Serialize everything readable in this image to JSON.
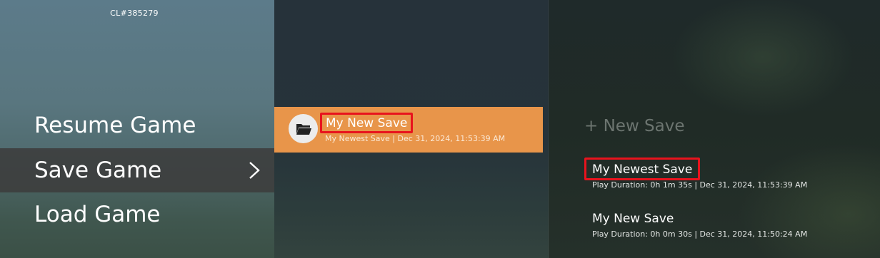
{
  "build_label": "CL#385279",
  "menu": {
    "items": [
      {
        "label": "Resume Game"
      },
      {
        "label": "Save Game"
      },
      {
        "label": "Load Game"
      }
    ]
  },
  "selected_save": {
    "title": "My New Save",
    "subtitle": "My Newest Save | Dec 31, 2024, 11:53:39 AM"
  },
  "save_list": {
    "new_save_label": "+ New Save",
    "entries": [
      {
        "title": "My Newest Save",
        "detail": "Play Duration: 0h 1m 35s | Dec 31, 2024, 11:53:39 AM"
      },
      {
        "title": "My New Save",
        "detail": "Play Duration: 0h 0m 30s | Dec 31, 2024, 11:50:24 AM"
      }
    ]
  },
  "colors": {
    "highlight_orange": "#e8954a",
    "annotation_red": "#e8131d",
    "menu_selected_bg": "#3c3c3c"
  },
  "icons": [
    "folder-icon",
    "chevron-right-icon"
  ]
}
